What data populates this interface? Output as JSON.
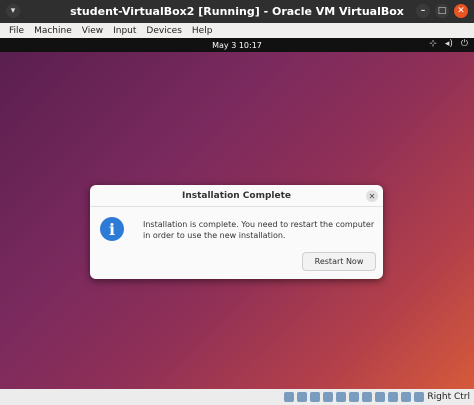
{
  "window": {
    "title": "student-VirtualBox2 [Running] - Oracle VM VirtualBox"
  },
  "menubar": {
    "items": [
      "File",
      "Machine",
      "View",
      "Input",
      "Devices",
      "Help"
    ]
  },
  "topbar": {
    "clock": "May 3  10:17"
  },
  "dialog": {
    "title": "Installation Complete",
    "message": "Installation is complete. You need to restart the computer in order to use the new installation.",
    "button": "Restart Now"
  },
  "statusbar": {
    "host_key": "Right Ctrl"
  }
}
